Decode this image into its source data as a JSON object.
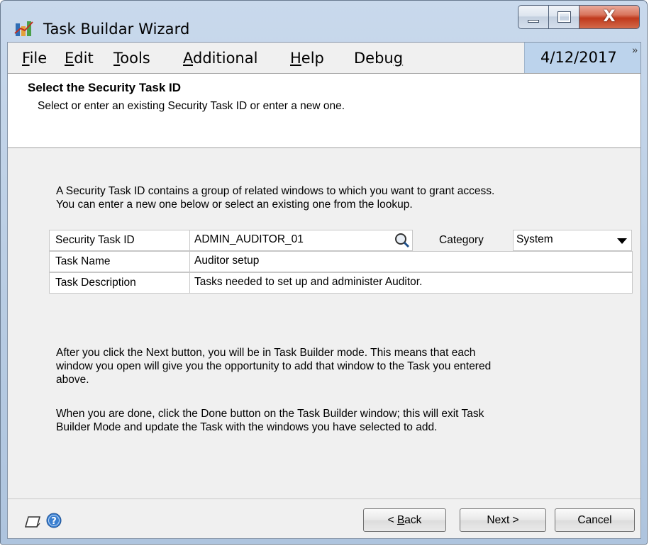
{
  "window": {
    "title": "Task Buildar Wizard",
    "close_glyph": "X"
  },
  "menu": {
    "items": [
      {
        "underline": "F",
        "rest": "ile"
      },
      {
        "underline": "E",
        "rest": "dit"
      },
      {
        "underline": "T",
        "rest": "ools"
      },
      {
        "underline": "A",
        "rest": "dditional"
      },
      {
        "underline": "H",
        "rest": "elp"
      },
      {
        "pre": "Debu",
        "underline": "g",
        "rest": ""
      }
    ],
    "date": "4/12/2017",
    "chevron": "»"
  },
  "header": {
    "title": "Select the Security Task ID",
    "subtitle": "Select or enter an existing Security Task ID or enter a new one."
  },
  "intro": {
    "line1": "A Security Task ID contains a group of related windows to which you want to grant access.",
    "line2": "You can enter a new one below or select an existing one from the lookup."
  },
  "form": {
    "task_id_label": "Security Task ID",
    "task_id_value": "ADMIN_AUDITOR_01",
    "category_label": "Category",
    "category_value": "System",
    "task_name_label": "Task Name",
    "task_name_value": "Auditor setup",
    "task_desc_label": "Task Description",
    "task_desc_value": "Tasks needed to set up and administer Auditor."
  },
  "info": {
    "p1_line1": "After you click the Next button, you will be in Task Builder mode.  This means that each",
    "p1_line2": "window you open will give you the opportunity to add that window to the Task you entered",
    "p1_line3": "above.",
    "p2_line1": "When you are done, click the Done button on the Task Builder window; this will exit Task",
    "p2_line2": "Builder Mode and update the Task with the windows you have selected to add."
  },
  "buttons": {
    "back_prefix": "< ",
    "back_underline": "B",
    "back_rest": "ack",
    "next": "Next >",
    "cancel": "Cancel"
  },
  "icons": {
    "app": "task-wizard-icon",
    "lookup": "magnifier-icon",
    "note": "note-icon",
    "help": "help-icon"
  }
}
